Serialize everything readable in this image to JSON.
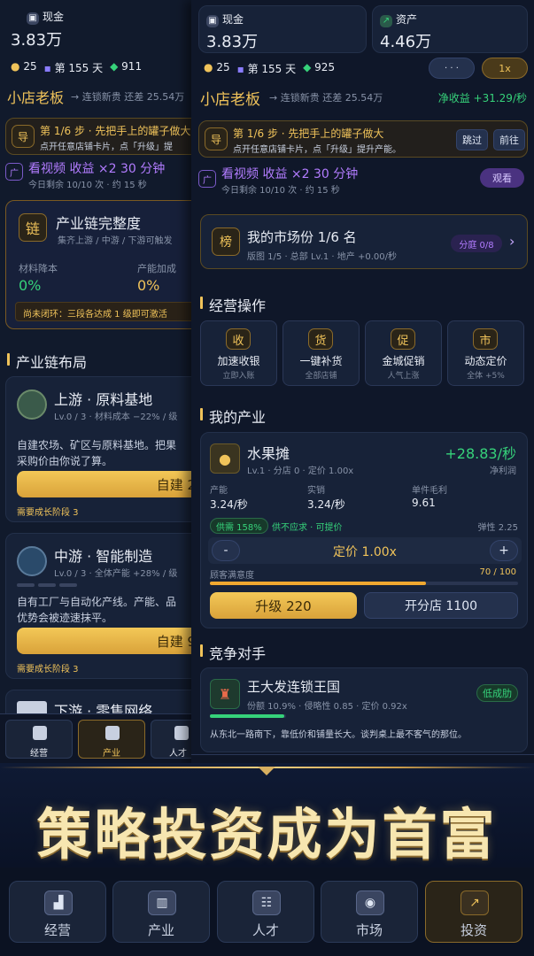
{
  "left": {
    "cash_label": "现金",
    "cash_value": "3.83万",
    "stat_a": "25",
    "stat_day": "第 155 天",
    "stat_b": "911",
    "title": "小店老板",
    "subtitle": "→ 连锁新贵 还差 25.54万",
    "task_title": "第 1/6 步 · 先把手上的罐子做大",
    "task_desc": "点开任意店铺卡片，点「升级」提",
    "video_title": "看视频 收益 ×2 30 分钟",
    "video_sub": "今日剩余 10/10 次 · 约 15 秒",
    "chain_icon": "链",
    "chain_title": "产业链完整度",
    "chain_sub": "集齐上游 / 中游 / 下游可触发",
    "mat_label": "材料降本",
    "mat_value": "0%",
    "cap_label": "产能加成",
    "cap_value": "0%",
    "chain_warn": "尚未闭环：三段各达成 1 级即可激活",
    "layout_title": "产业链布局",
    "up_title": "上游 · 原料基地",
    "up_meta": "Lv.0 / 3 · 材料成本 −22% / 级",
    "up_desc1": "自建农场、矿区与原料基地。把果",
    "up_desc2": "采购价由你说了算。",
    "up_btn": "自建 2",
    "up_req": "需要成长阶段 3",
    "mid_title": "中游 · 智能制造",
    "mid_meta": "Lv.0 / 3 · 全体产能 +28% / 级",
    "mid_desc1": "自有工厂与自动化产线。产能、品",
    "mid_desc2": "优势会被迹速抹平。",
    "mid_btn": "自建 9",
    "mid_req": "需要成长阶段 3",
    "down_title": "下游 · 零售网络",
    "nav": [
      "经营",
      "产业",
      "人才"
    ]
  },
  "right": {
    "cash_label": "现金",
    "cash_value": "3.83万",
    "asset_label": "资产",
    "asset_value": "4.46万",
    "stat_a": "25",
    "stat_day": "第 155 天",
    "stat_b": "925",
    "dots": "· · ·",
    "speed": "1x",
    "title": "小店老板",
    "subtitle": "→ 连锁新贵 还差 25.54万",
    "income": "净收益 +31.29/秒",
    "task_title": "第 1/6 步 · 先把手上的罐子做大",
    "task_desc": "点开任意店铺卡片，点「升级」提升产能。",
    "skip": "跳过",
    "go": "前往",
    "video_title": "看视频 收益 ×2 30 分钟",
    "video_sub": "今日剩余 10/10 次 · 约 15 秒",
    "watch": "观看",
    "rank_icon": "榜",
    "rank_title": "我的市场份 1/6 名",
    "rank_sub": "版图 1/5 · 总部 Lv.1 · 地产 +0.00/秒",
    "share_btn": "分庭 0/8",
    "ops_title": "经营操作",
    "ops": [
      {
        "icon": "收",
        "title": "加速收银",
        "sub": "立即入账"
      },
      {
        "icon": "货",
        "title": "一键补货",
        "sub": "全部店铺"
      },
      {
        "icon": "促",
        "title": "金城促销",
        "sub": "人气上涨"
      },
      {
        "icon": "市",
        "title": "动态定价",
        "sub": "全体 +5%"
      }
    ],
    "ind_title": "我的产业",
    "shop_name": "水果摊",
    "shop_meta": "Lv.1 · 分店 0 · 定价 1.00x",
    "shop_profit": "+28.83/秒",
    "shop_profit_label": "净利润",
    "prod_label": "产能",
    "prod_value": "3.24/秒",
    "sale_label": "实销",
    "sale_value": "3.24/秒",
    "margin_label": "单件毛利",
    "margin_value": "9.61",
    "supply_badge": "供需 158%",
    "supply_text": "供不应求 · 可提价",
    "elastic": "弹性 2.25",
    "minus": "-",
    "price": "定价 1.00x",
    "plus": "+",
    "satis_label": "顾客满意度",
    "satis_value": "70 / 100",
    "satis": 70,
    "upgrade": "升级 220",
    "branch": "开分店 1100",
    "comp_title": "竞争对手",
    "rival_name": "王大发连锁王国",
    "rival_meta": "份额 10.9% · 侵略性 0.85 · 定价 0.92x",
    "rival_badge": "低成肋",
    "rival_share": 10.9,
    "rival_desc": "从东北一路南下，靠低价和铺量长大。谈判桌上最不客气的那位。"
  },
  "banner": "策略投资成为首富",
  "nav": [
    {
      "label": "经营",
      "icon": "bag-icon",
      "glyph": "▟"
    },
    {
      "label": "产业",
      "icon": "factory-icon",
      "glyph": "▥"
    },
    {
      "label": "人才",
      "icon": "people-icon",
      "glyph": "☷"
    },
    {
      "label": "市场",
      "icon": "market-icon",
      "glyph": "◉"
    },
    {
      "label": "投资",
      "icon": "chart-up-icon",
      "glyph": "↗"
    }
  ],
  "colors": {
    "gold": "#f0c35a",
    "green": "#36d27a",
    "purple": "#b27cff",
    "bg": "#0a1020"
  }
}
